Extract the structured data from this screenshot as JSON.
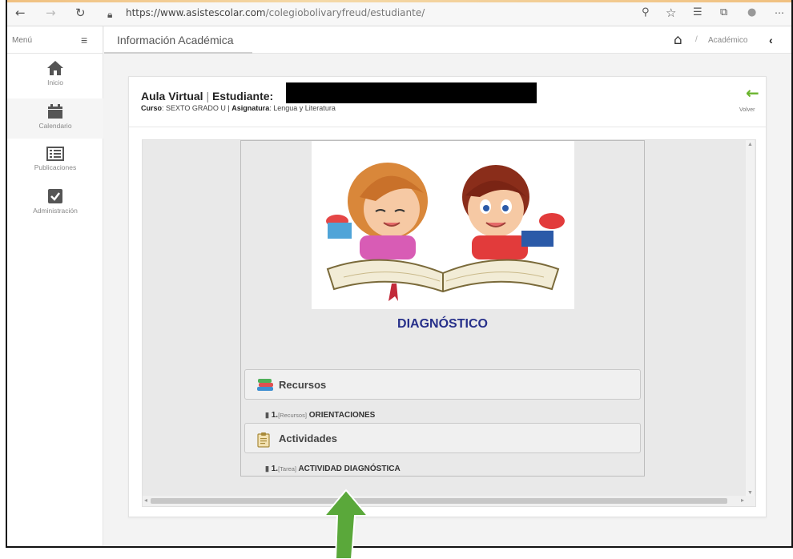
{
  "browser": {
    "url_host": "https://www.asistescolar.com",
    "url_path": "/colegiobolivaryfreud/estudiante/"
  },
  "menu": {
    "label": "Menú"
  },
  "header": {
    "title": "Información Académica",
    "breadcrumb": "Académico"
  },
  "sidebar": {
    "items": [
      {
        "label": "Inicio",
        "icon": "home-icon"
      },
      {
        "label": "Calendario",
        "icon": "calendar-icon"
      },
      {
        "label": "Publicaciones",
        "icon": "list-icon"
      },
      {
        "label": "Administración",
        "icon": "checkbox-icon"
      }
    ]
  },
  "card": {
    "title_a": "Aula Virtual",
    "title_b": "Estudiante:",
    "curso_label": "Curso",
    "curso_value": "SEXTO GRADO U",
    "asignatura_label": "Asignatura",
    "asignatura_value": "Lengua y Literatura",
    "back_label": "Volver"
  },
  "content": {
    "title": "DIAGNÓSTICO",
    "sections": [
      {
        "name": "Recursos",
        "items": [
          {
            "num": "1.",
            "tag": "[Recursos]",
            "text": "ORIENTACIONES"
          }
        ]
      },
      {
        "name": "Actividades",
        "items": [
          {
            "num": "1.",
            "tag": "[Tarea]",
            "text": "ACTIVIDAD DIAGNÓSTICA"
          }
        ]
      }
    ]
  },
  "colors": {
    "accent_green": "#6ab42d",
    "title_blue": "#27308a",
    "annotation_green": "#5aa83a"
  }
}
